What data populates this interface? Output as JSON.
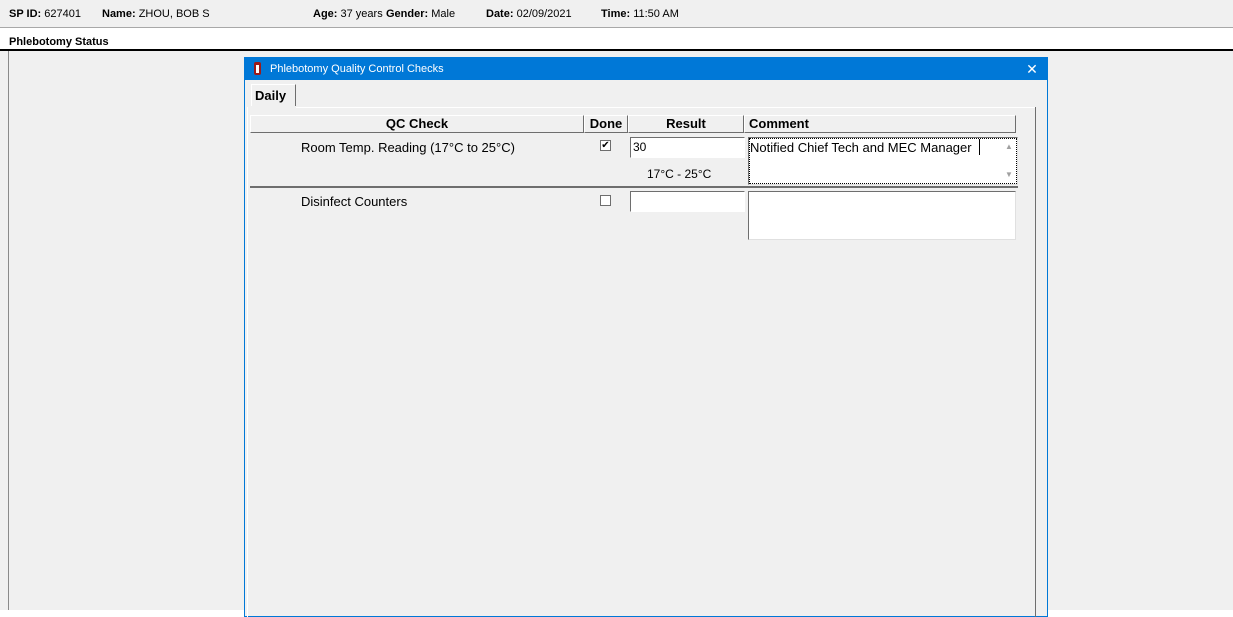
{
  "patient": {
    "sp_id_label": "SP ID:",
    "sp_id": "627401",
    "name_label": "Name:",
    "name": "ZHOU, BOB S",
    "age_label": "Age:",
    "age": "37 years",
    "gender_label": "Gender:",
    "gender": "Male",
    "date_label": "Date:",
    "date": "02/09/2021",
    "time_label": "Time:",
    "time": "11:50 AM"
  },
  "section_title": "Phlebotomy Status",
  "dialog": {
    "title": "Phlebotomy Quality Control Checks",
    "close_glyph": "✕",
    "icon": "tube-icon",
    "tab_label": "Daily"
  },
  "table": {
    "columns": [
      "QC Check",
      "Done",
      "Result",
      "Comment"
    ],
    "rows": [
      {
        "check": "Room Temp. Reading (17°C to 25°C)",
        "done": true,
        "result": "30",
        "range": "17°C - 25°C",
        "comment": "Notified Chief Tech and MEC Manager"
      },
      {
        "check": "Disinfect Counters",
        "done": false,
        "result": "",
        "range": "",
        "comment": ""
      }
    ]
  }
}
